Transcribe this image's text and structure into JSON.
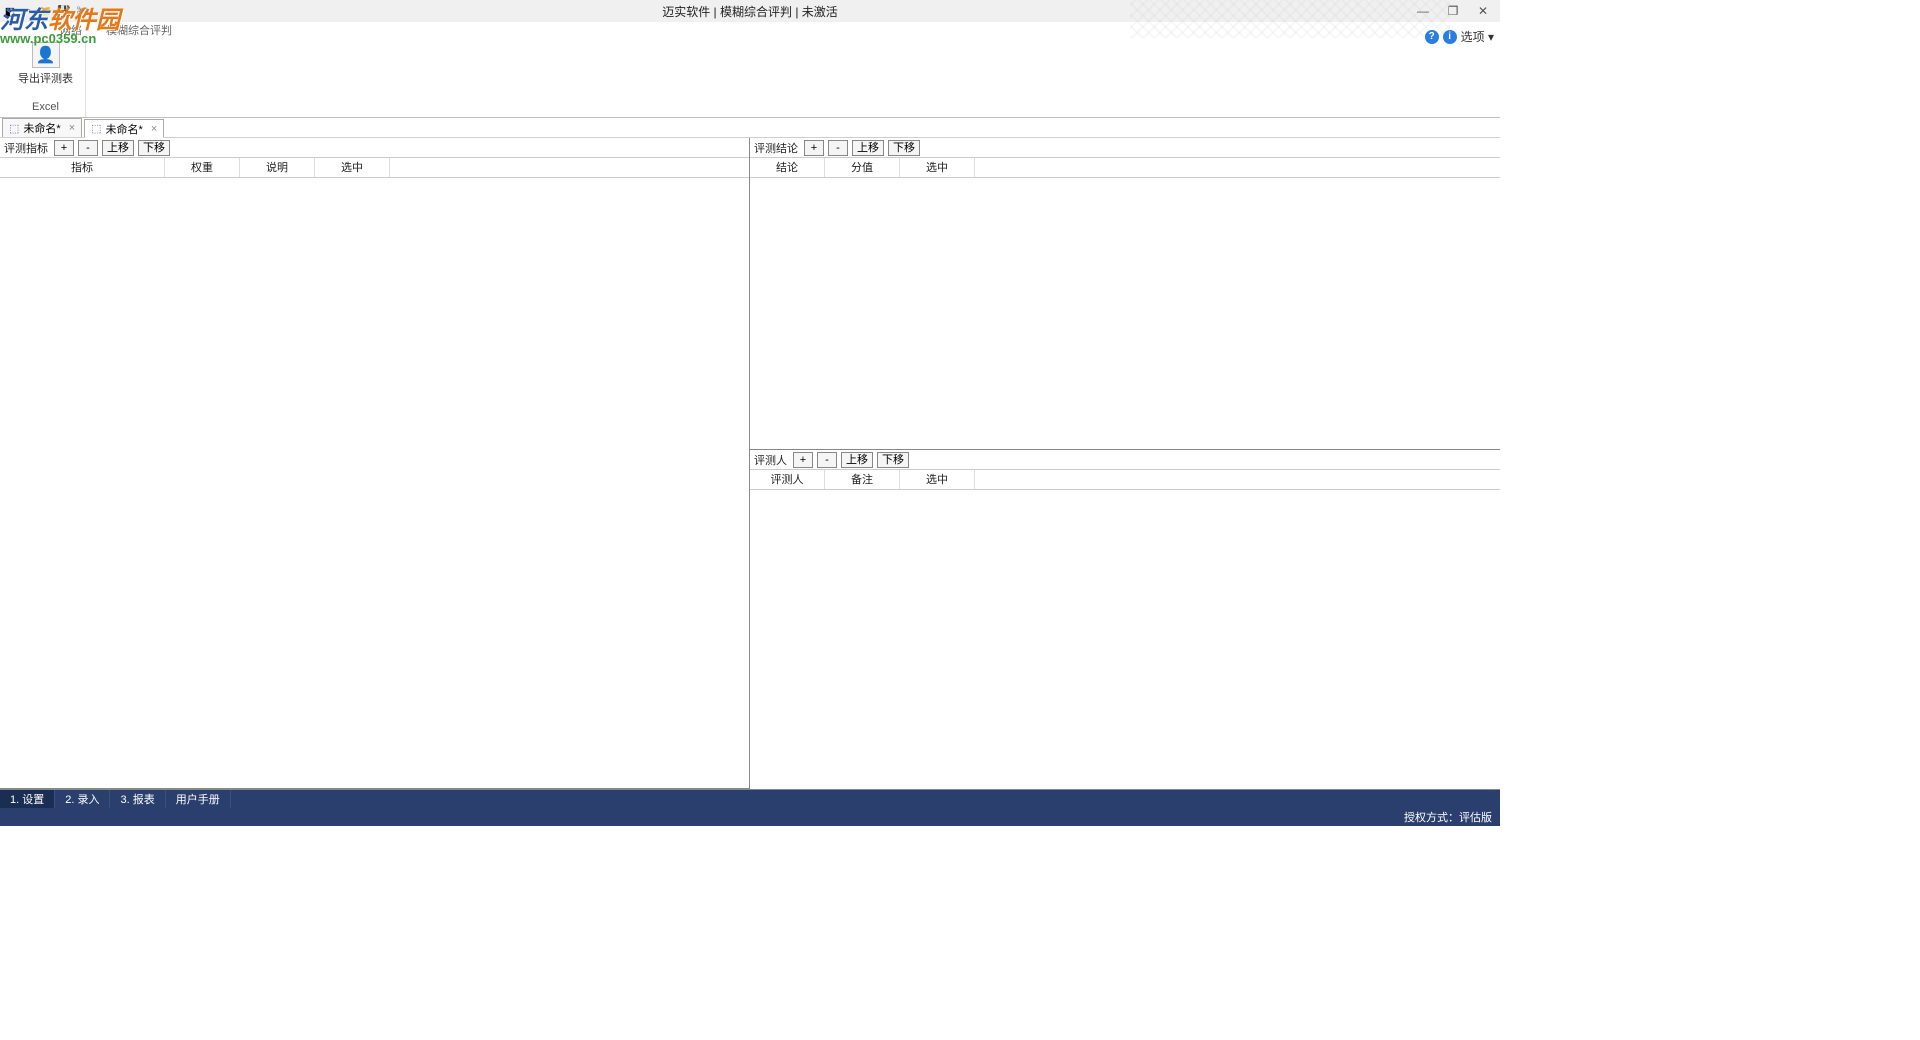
{
  "watermark": {
    "brand_a": "河东",
    "brand_b": "软件园",
    "url": "www.pc0359.cn"
  },
  "titlebar": {
    "title": "迈实软件 | 模糊综合评判 | 未激活",
    "controls": {
      "min": "—",
      "max": "❐",
      "close": "✕"
    }
  },
  "row2": {
    "label_a": "网络",
    "label_b": "模糊综合评判"
  },
  "header_right": {
    "options": "选项 ▾"
  },
  "ribbon": {
    "export_btn": "导出评测表",
    "group_label": "Excel"
  },
  "doc_tabs": [
    {
      "label": "未命名*",
      "active": false
    },
    {
      "label": "未命名*",
      "active": true
    }
  ],
  "panels": {
    "indicators": {
      "title": "评测指标",
      "buttons": {
        "add": "+",
        "remove": "-",
        "up": "上移",
        "down": "下移"
      },
      "columns": [
        "指标",
        "权重",
        "说明",
        "选中"
      ]
    },
    "conclusions": {
      "title": "评测结论",
      "buttons": {
        "add": "+",
        "remove": "-",
        "up": "上移",
        "down": "下移"
      },
      "columns": [
        "结论",
        "分值",
        "选中"
      ]
    },
    "reviewers": {
      "title": "评测人",
      "buttons": {
        "add": "+",
        "remove": "-",
        "up": "上移",
        "down": "下移"
      },
      "columns": [
        "评测人",
        "备注",
        "选中"
      ]
    }
  },
  "bottom_tabs": [
    "1. 设置",
    "2. 录入",
    "3. 报表",
    "用户手册"
  ],
  "status": {
    "license": "授权方式：评估版"
  }
}
